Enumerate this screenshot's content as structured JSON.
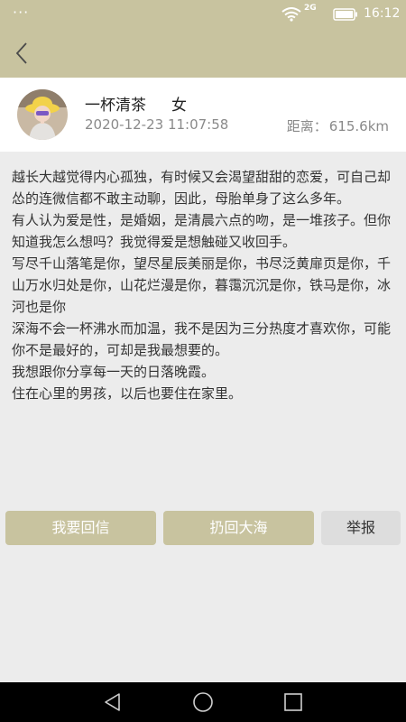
{
  "status_bar": {
    "dots": "···",
    "network_label": "2G",
    "time": "16:12",
    "icons": [
      "wifi-icon",
      "battery-icon"
    ]
  },
  "header": {
    "back_icon": "chevron-left-icon"
  },
  "profile": {
    "name": "一杯清茶",
    "gender": "女",
    "datetime": "2020-12-23 11:07:58",
    "distance_label": "距离：",
    "distance_value": "615.6km"
  },
  "letter": {
    "paragraphs": [
      "越长大越觉得内心孤独，有时候又会渴望甜甜的恋爱，可自己却怂的连微信都不敢主动聊，因此，母胎单身了这么多年。",
      "有人认为爱是性，是婚姻，是清晨六点的吻，是一堆孩子。但你知道我怎么想吗？我觉得爱是想触碰又收回手。",
      "写尽千山落笔是你，望尽星辰美丽是你，书尽泛黄扉页是你，千山万水归处是你，山花烂漫是你，暮霭沉沉是你，铁马是你，冰河也是你",
      "深海不会一杯沸水而加温，我不是因为三分热度才喜欢你，可能你不是最好的，可却是我最想要的。",
      "我想跟你分享每一天的日落晚霞。",
      "住在心里的男孩，以后也要住在家里。"
    ]
  },
  "actions": {
    "reply": "我要回信",
    "throw_back": "扔回大海",
    "report": "举报"
  },
  "system_nav": {
    "icons": [
      "back-triangle-icon",
      "home-circle-icon",
      "recents-square-icon"
    ]
  },
  "colors": {
    "accent": "#c8c39f",
    "page_bg": "#ececec",
    "card_bg": "#ffffff",
    "report_bg": "#dddddd",
    "nav_bg": "#000000"
  }
}
